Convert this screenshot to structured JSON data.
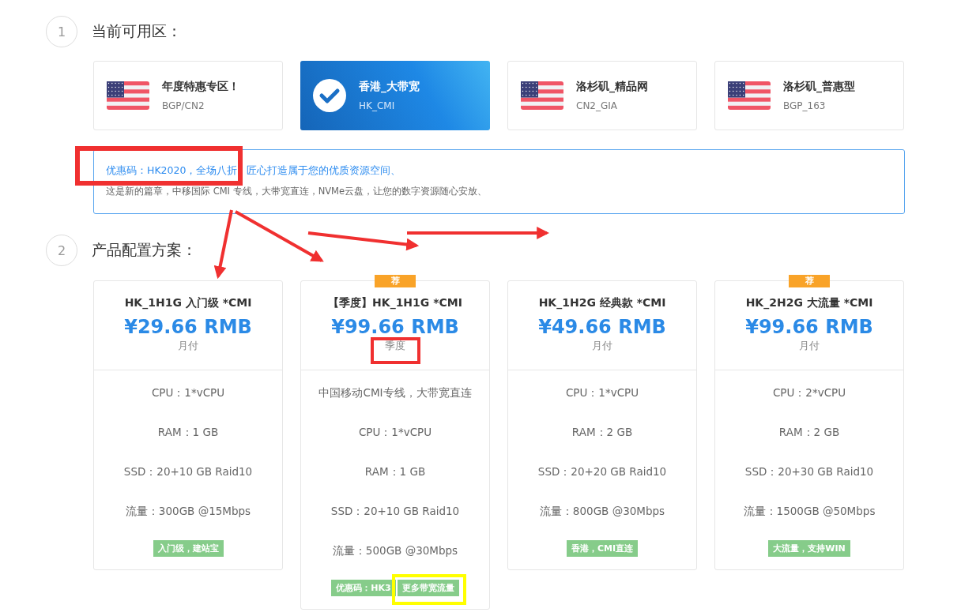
{
  "zone_step": {
    "number": "1",
    "title": "当前可用区："
  },
  "zones": [
    {
      "name": "年度特惠专区！",
      "line": "BGP/CN2",
      "selected": false
    },
    {
      "name": "香港_大带宽",
      "line": "HK_CMI",
      "selected": true
    },
    {
      "name": "洛杉矶_精品网",
      "line": "CN2_GIA",
      "selected": false
    },
    {
      "name": "洛杉矶_普惠型",
      "line": "BGP_163",
      "selected": false
    }
  ],
  "notice": {
    "promo": "优惠码：HK2020，全场八折",
    "slogan": "匠心打造属于您的优质资源空间、",
    "description": "这是新的篇章，中移国际 CMI 专线，大带宽直连，NVMe云盘，让您的数字资源随心安放、"
  },
  "plan_step": {
    "number": "2",
    "title": "产品配置方案："
  },
  "plans": [
    {
      "title": "HK_1H1G 入门级 *CMI",
      "price": "¥29.66 RMB",
      "period": "月付",
      "specs": [
        "CPU：1*vCPU",
        "RAM：1 GB",
        "SSD：20+10 GB Raid10",
        "流量：300GB @15Mbps"
      ],
      "tags": [
        "入门级，建站宝"
      ]
    },
    {
      "badge": "荐",
      "title": "【季度】HK_1H1G *CMI",
      "price": "¥99.66 RMB",
      "period": "季度",
      "specs": [
        "中国移动CMI专线，大带宽直连",
        "CPU：1*vCPU",
        "RAM：1 GB",
        "SSD：20+10 GB Raid10",
        "流量：500GB @30Mbps"
      ],
      "tags": [
        "优惠码：HK3",
        "更多带宽流量"
      ]
    },
    {
      "title": "HK_1H2G 经典款 *CMI",
      "price": "¥49.66 RMB",
      "period": "月付",
      "specs": [
        "CPU：1*vCPU",
        "RAM：2 GB",
        "SSD：20+20 GB Raid10",
        "流量：800GB @30Mbps"
      ],
      "tags": [
        "香港，CMI直连"
      ]
    },
    {
      "badge": "荐",
      "title": "HK_2H2G 大流量 *CMI",
      "price": "¥99.66 RMB",
      "period": "月付",
      "specs": [
        "CPU：2*vCPU",
        "RAM：2 GB",
        "SSD：20+30 GB Raid10",
        "流量：1500GB @50Mbps"
      ],
      "tags": [
        "大流量，支持WIN"
      ]
    }
  ]
}
